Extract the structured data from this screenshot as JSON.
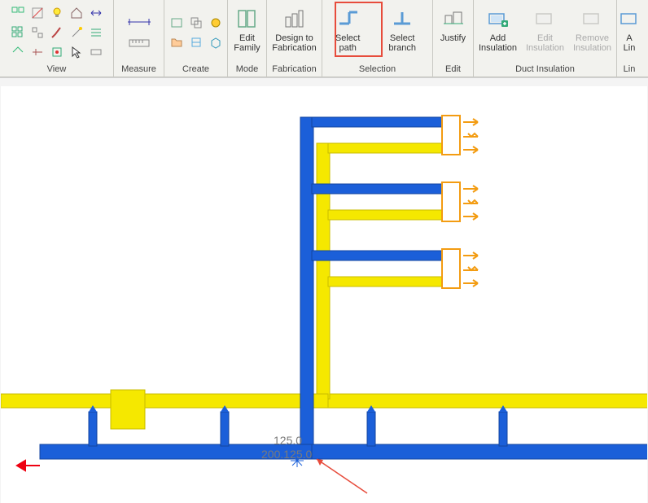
{
  "ribbon": {
    "panels": {
      "view": {
        "label": "View"
      },
      "measure": {
        "label": "Measure"
      },
      "create": {
        "label": "Create"
      },
      "mode": {
        "label": "Mode",
        "edit_family": "Edit\nFamily"
      },
      "fabrication": {
        "label": "Fabrication",
        "design_to": "Design to\nFabrication"
      },
      "selection": {
        "label": "Selection",
        "select_path": "Select path",
        "select_branch": "Select branch"
      },
      "edit": {
        "label": "Edit",
        "justify": "Justify"
      },
      "duct_insulation": {
        "label": "Duct Insulation",
        "add": "Add\nInsulation",
        "edit_ins": "Edit\nInsulation",
        "remove": "Remove\nInsulation"
      },
      "lining": {
        "label": "Lin",
        "add_lining": "A\nLin"
      }
    }
  },
  "canvas": {
    "dim1": "125.0",
    "dim2": "200.125.0"
  },
  "colors": {
    "duct_blue": "#1b5fd9",
    "duct_yellow": "#f5e800",
    "terminal_orange": "#f39c12",
    "highlight": "#e74c3c"
  }
}
